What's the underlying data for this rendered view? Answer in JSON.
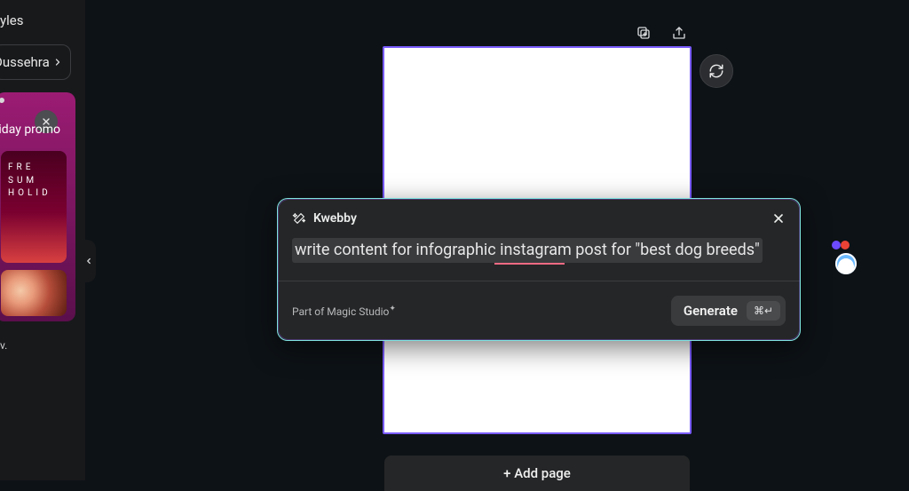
{
  "sidebar": {
    "top_link": "yles",
    "pill": "Dussehra",
    "template": {
      "title": "liday promo",
      "lines": [
        "FRE",
        "SUM",
        "HOLID"
      ]
    },
    "footer_letter": "v."
  },
  "canvas": {
    "add_page_label": "+ Add page"
  },
  "ai_panel": {
    "title": "Kwebby",
    "prompt": "write content for infographic instagram post for \"best dog breeds\"",
    "footer_text": "Part of Magic Studio",
    "footer_sup": "✦",
    "generate_label": "Generate",
    "shortcut": "⌘↵"
  }
}
